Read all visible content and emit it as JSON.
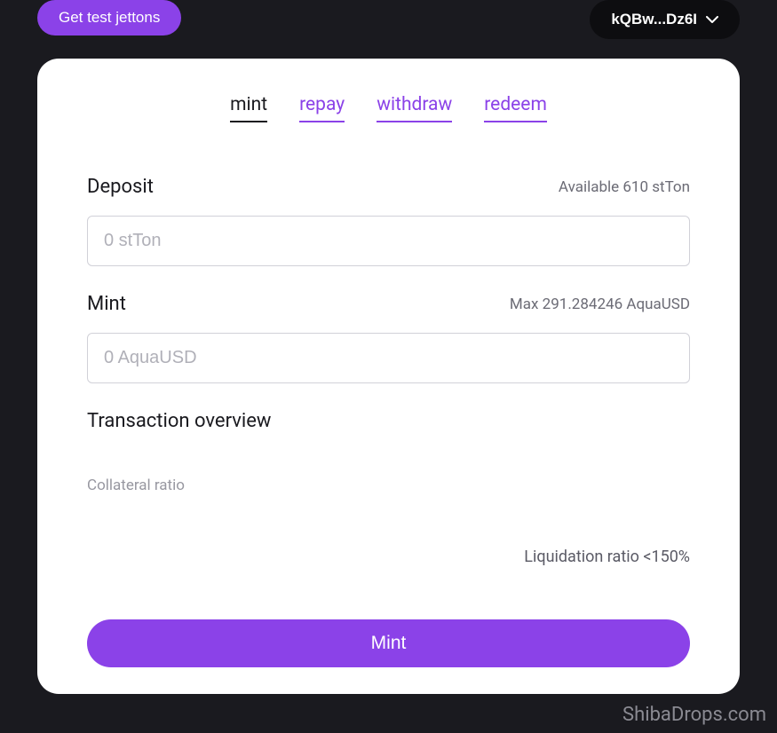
{
  "header": {
    "get_jettons_label": "Get test jettons",
    "wallet_address": "kQBw...Dz6I"
  },
  "tabs": {
    "mint": "mint",
    "repay": "repay",
    "withdraw": "withdraw",
    "redeem": "redeem"
  },
  "deposit": {
    "label": "Deposit",
    "available": "Available 610 stTon",
    "placeholder": "0 stTon"
  },
  "mint": {
    "label": "Mint",
    "max": "Max 291.284246 AquaUSD",
    "placeholder": "0 AquaUSD"
  },
  "overview": {
    "title": "Transaction overview",
    "collateral_label": "Collateral ratio",
    "liquidation_text": "Liquidation ratio <150%"
  },
  "action": {
    "mint_button": "Mint"
  },
  "watermark": "ShibaDrops.com"
}
